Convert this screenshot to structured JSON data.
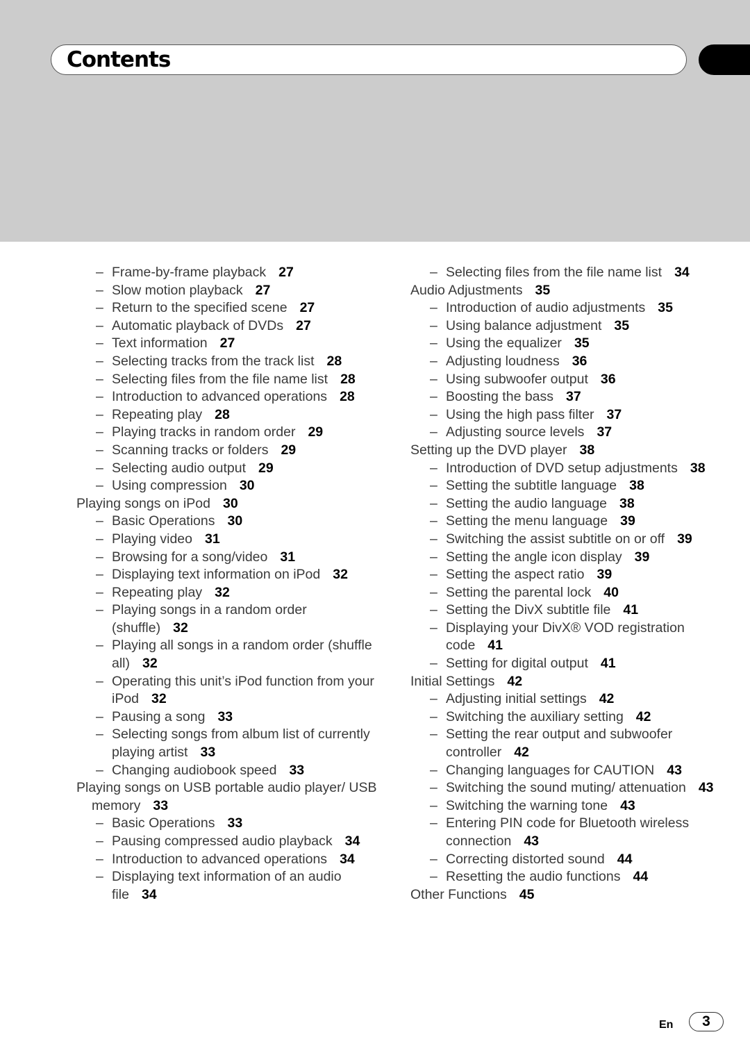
{
  "header": {
    "title": "Contents"
  },
  "footer": {
    "language": "En",
    "page_number": "3"
  },
  "left_column": [
    {
      "level": 2,
      "text": "Frame-by-frame playback",
      "page": "27"
    },
    {
      "level": 2,
      "text": "Slow motion playback",
      "page": "27"
    },
    {
      "level": 2,
      "text": "Return to the specified scene",
      "page": "27"
    },
    {
      "level": 2,
      "text": "Automatic playback of DVDs",
      "page": "27"
    },
    {
      "level": 2,
      "text": "Text information",
      "page": "27"
    },
    {
      "level": 2,
      "text": "Selecting tracks from the track list",
      "page": "28"
    },
    {
      "level": 2,
      "text": "Selecting files from the file name list",
      "page": "28"
    },
    {
      "level": 2,
      "text": "Introduction to advanced operations",
      "page": "28"
    },
    {
      "level": 2,
      "text": "Repeating play",
      "page": "28"
    },
    {
      "level": 2,
      "text": "Playing tracks in random order",
      "page": "29"
    },
    {
      "level": 2,
      "text": "Scanning tracks or folders",
      "page": "29"
    },
    {
      "level": 2,
      "text": "Selecting audio output",
      "page": "29"
    },
    {
      "level": 2,
      "text": "Using compression",
      "page": "30"
    },
    {
      "level": 1,
      "text": "Playing songs on iPod",
      "page": "30"
    },
    {
      "level": 2,
      "text": "Basic Operations",
      "page": "30"
    },
    {
      "level": 2,
      "text": "Playing video",
      "page": "31"
    },
    {
      "level": 2,
      "text": "Browsing for a song/video",
      "page": "31"
    },
    {
      "level": 2,
      "text": "Displaying text information on iPod",
      "page": "32"
    },
    {
      "level": 2,
      "text": "Repeating play",
      "page": "32"
    },
    {
      "level": 2,
      "text": "Playing songs in a random order (shuffle)",
      "page": "32"
    },
    {
      "level": 2,
      "text": "Playing all songs in a random order (shuffle all)",
      "page": "32"
    },
    {
      "level": 2,
      "text": "Operating this unit’s iPod function from your iPod",
      "page": "32"
    },
    {
      "level": 2,
      "text": "Pausing a song",
      "page": "33"
    },
    {
      "level": 2,
      "text": "Selecting songs from album list of currently playing artist",
      "page": "33"
    },
    {
      "level": 2,
      "text": "Changing audiobook speed",
      "page": "33"
    },
    {
      "level": 1,
      "text": "Playing songs on USB portable audio player/ USB memory",
      "page": "33"
    },
    {
      "level": 2,
      "text": "Basic Operations",
      "page": "33"
    },
    {
      "level": 2,
      "text": "Pausing compressed audio playback",
      "page": "34"
    },
    {
      "level": 2,
      "text": "Introduction to advanced operations",
      "page": "34"
    },
    {
      "level": 2,
      "text": "Displaying text information of an audio file",
      "page": "34"
    }
  ],
  "right_column": [
    {
      "level": 2,
      "text": "Selecting files from the file name list",
      "page": "34"
    },
    {
      "level": 1,
      "text": "Audio Adjustments",
      "page": "35"
    },
    {
      "level": 2,
      "text": "Introduction of audio adjustments",
      "page": "35"
    },
    {
      "level": 2,
      "text": "Using balance adjustment",
      "page": "35"
    },
    {
      "level": 2,
      "text": "Using the equalizer",
      "page": "35"
    },
    {
      "level": 2,
      "text": "Adjusting loudness",
      "page": "36"
    },
    {
      "level": 2,
      "text": "Using subwoofer output",
      "page": "36"
    },
    {
      "level": 2,
      "text": "Boosting the bass",
      "page": "37"
    },
    {
      "level": 2,
      "text": "Using the high pass filter",
      "page": "37"
    },
    {
      "level": 2,
      "text": "Adjusting source levels",
      "page": "37"
    },
    {
      "level": 1,
      "text": "Setting up the DVD player",
      "page": "38"
    },
    {
      "level": 2,
      "text": "Introduction of DVD setup adjustments",
      "page": "38"
    },
    {
      "level": 2,
      "text": "Setting the subtitle language",
      "page": "38"
    },
    {
      "level": 2,
      "text": "Setting the audio language",
      "page": "38"
    },
    {
      "level": 2,
      "text": "Setting the menu language",
      "page": "39"
    },
    {
      "level": 2,
      "text": "Switching the assist subtitle on or off",
      "page": "39"
    },
    {
      "level": 2,
      "text": "Setting the angle icon display",
      "page": "39"
    },
    {
      "level": 2,
      "text": "Setting the aspect ratio",
      "page": "39"
    },
    {
      "level": 2,
      "text": "Setting the parental lock",
      "page": "40"
    },
    {
      "level": 2,
      "text": "Setting the DivX subtitle file",
      "page": "41"
    },
    {
      "level": 2,
      "text": "Displaying your DivX® VOD registration code",
      "page": "41"
    },
    {
      "level": 2,
      "text": "Setting for digital output",
      "page": "41"
    },
    {
      "level": 1,
      "text": "Initial Settings",
      "page": "42"
    },
    {
      "level": 2,
      "text": "Adjusting initial settings",
      "page": "42"
    },
    {
      "level": 2,
      "text": "Switching the auxiliary setting",
      "page": "42"
    },
    {
      "level": 2,
      "text": "Setting the rear output and subwoofer controller",
      "page": "42"
    },
    {
      "level": 2,
      "text": "Changing languages for CAUTION",
      "page": "43"
    },
    {
      "level": 2,
      "text": "Switching the sound muting/ attenuation",
      "page": "43"
    },
    {
      "level": 2,
      "text": "Switching the warning tone",
      "page": "43"
    },
    {
      "level": 2,
      "text": "Entering PIN code for Bluetooth wireless connection",
      "page": "43"
    },
    {
      "level": 2,
      "text": "Correcting distorted sound",
      "page": "44"
    },
    {
      "level": 2,
      "text": "Resetting the audio functions",
      "page": "44"
    },
    {
      "level": 1,
      "text": "Other Functions",
      "page": "45"
    }
  ]
}
